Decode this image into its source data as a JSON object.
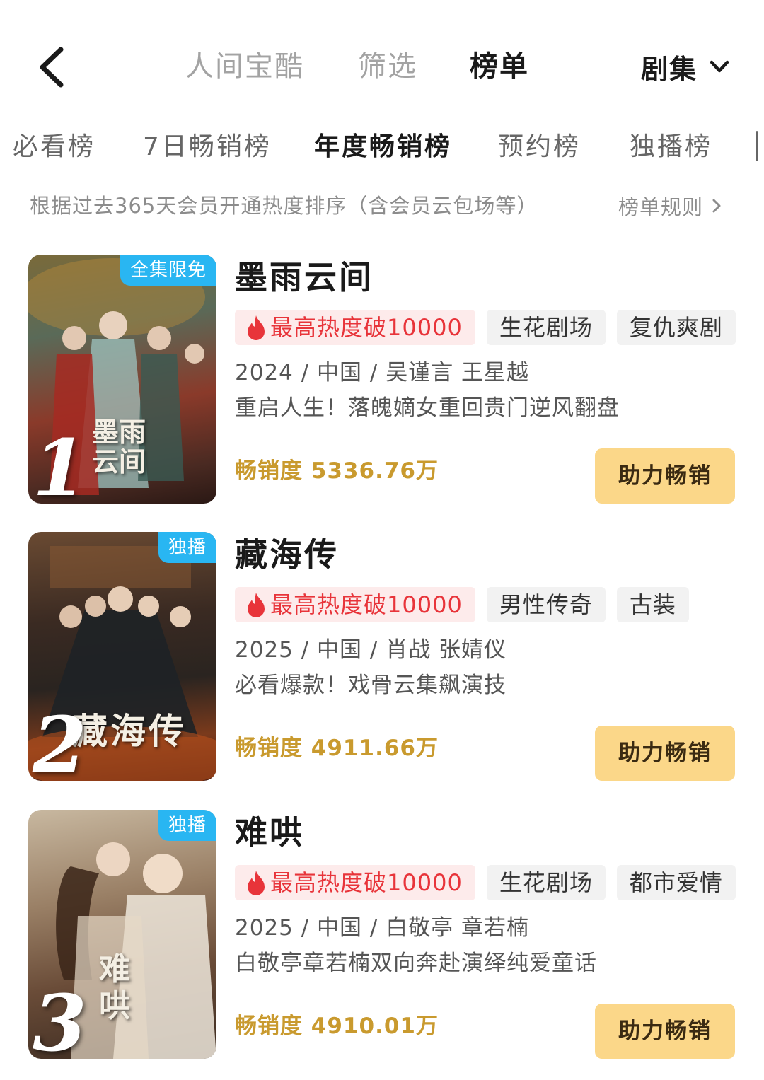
{
  "header": {
    "tabs": [
      {
        "label": "人间宝酷",
        "active": false
      },
      {
        "label": "筛选",
        "active": false
      },
      {
        "label": "榜单",
        "active": true
      }
    ],
    "category": "剧集"
  },
  "subtabs": [
    {
      "label": "必看榜",
      "active": false
    },
    {
      "label": "7日畅销榜",
      "active": false
    },
    {
      "label": "年度畅销榜",
      "active": true
    },
    {
      "label": "预约榜",
      "active": false
    },
    {
      "label": "独播榜",
      "active": false
    }
  ],
  "description": {
    "text": "根据过去365天会员开通热度排序（含会员云包场等）",
    "rules_link": "榜单规则"
  },
  "colors": {
    "accent_gold": "#c99a2e",
    "button_bg": "#fbd789",
    "hot_red": "#e8343a",
    "badge_blue": "#29b6f2"
  },
  "items": [
    {
      "rank": "1",
      "badge": "全集限免",
      "poster_title": "墨雨云间",
      "title": "墨雨云间",
      "hot_tag": "最高热度破10000",
      "tags": [
        "生花剧场",
        "复仇爽剧"
      ],
      "meta": "2024 / 中国 / 吴谨言 王星越",
      "blurb": "重启人生！落魄嫡女重回贵门逆风翻盘",
      "sales": "畅销度 5336.76万",
      "button": "助力畅销"
    },
    {
      "rank": "2",
      "badge": "独播",
      "poster_title": "藏海传",
      "title": "藏海传",
      "hot_tag": "最高热度破10000",
      "tags": [
        "男性传奇",
        "古装"
      ],
      "meta": "2025 / 中国 / 肖战 张婧仪",
      "blurb": "必看爆款！戏骨云集飙演技",
      "sales": "畅销度 4911.66万",
      "button": "助力畅销"
    },
    {
      "rank": "3",
      "badge": "独播",
      "poster_title": "难哄",
      "title": "难哄",
      "hot_tag": "最高热度破10000",
      "tags": [
        "生花剧场",
        "都市爱情"
      ],
      "meta": "2025 / 中国 / 白敬亭 章若楠",
      "blurb": "白敬亭章若楠双向奔赴演绎纯爱童话",
      "sales": "畅销度 4910.01万",
      "button": "助力畅销"
    }
  ]
}
